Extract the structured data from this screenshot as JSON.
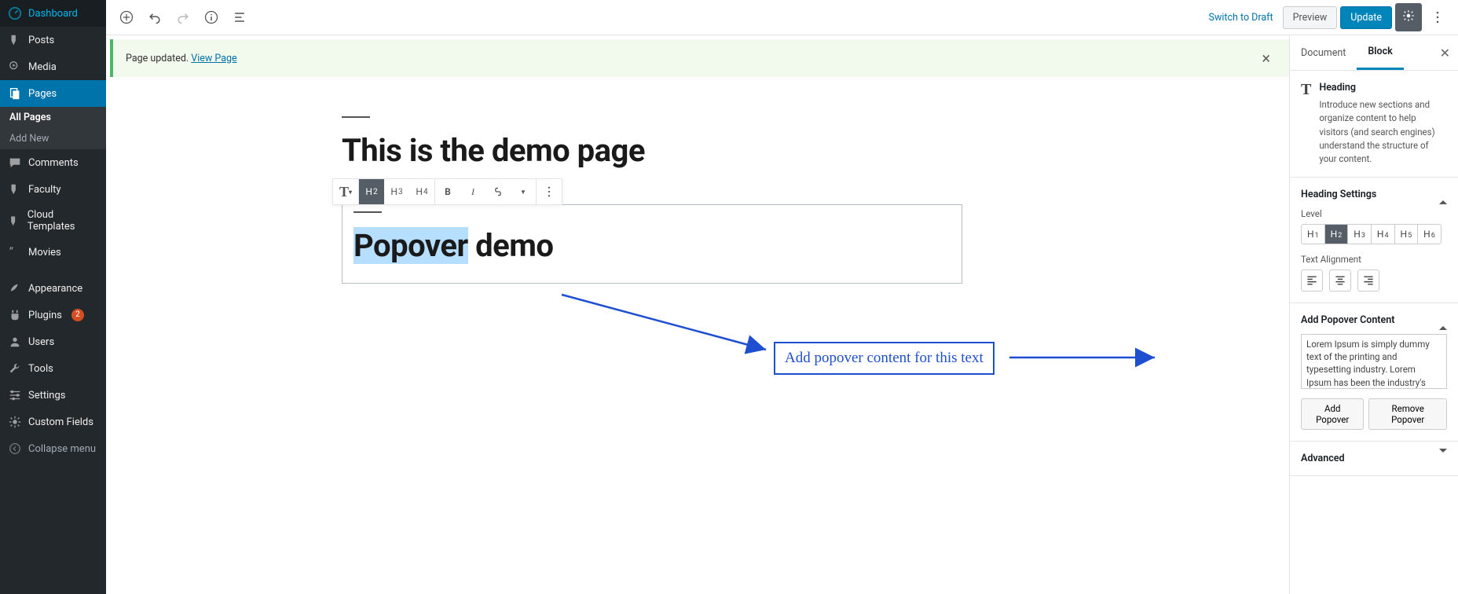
{
  "sidebar": {
    "items": [
      {
        "label": "Dashboard",
        "icon": "dashboard"
      },
      {
        "label": "Posts",
        "icon": "pin"
      },
      {
        "label": "Media",
        "icon": "media"
      },
      {
        "label": "Pages",
        "icon": "pages",
        "active": true
      },
      {
        "label": "Comments",
        "icon": "comments"
      },
      {
        "label": "Faculty",
        "icon": "pin"
      },
      {
        "label": "Cloud Templates",
        "icon": "pin"
      },
      {
        "label": "Movies",
        "icon": "quote"
      },
      {
        "label": "Appearance",
        "icon": "brush"
      },
      {
        "label": "Plugins",
        "icon": "plug",
        "badge": "2"
      },
      {
        "label": "Users",
        "icon": "user"
      },
      {
        "label": "Tools",
        "icon": "wrench"
      },
      {
        "label": "Settings",
        "icon": "sliders"
      },
      {
        "label": "Custom Fields",
        "icon": "cog"
      },
      {
        "label": "Collapse menu",
        "icon": "collapse"
      }
    ],
    "sub": [
      {
        "label": "All Pages",
        "current": true
      },
      {
        "label": "Add New"
      }
    ]
  },
  "topbar": {
    "switch_link": "Switch to Draft",
    "preview": "Preview",
    "update": "Update"
  },
  "notice": {
    "text": "Page updated. ",
    "link": "View Page"
  },
  "canvas": {
    "h1": "This is the demo page",
    "h2_sel": "Popover",
    "h2_rest": " demo"
  },
  "annotation": "Add popover content for this text",
  "rpanel": {
    "tabs": {
      "document": "Document",
      "block": "Block"
    },
    "block_title": "Heading",
    "block_desc": "Introduce new sections and organize content to help visitors (and search engines) understand the structure of your content.",
    "heading_settings": "Heading Settings",
    "level_label": "Level",
    "levels": [
      "1",
      "2",
      "3",
      "4",
      "5",
      "6"
    ],
    "level_active": "2",
    "align_label": "Text Alignment",
    "popover_title": "Add Popover Content",
    "popover_text": "Lorem Ipsum is simply dummy text of the printing and typesetting industry. Lorem Ipsum has been the industry's standard dummy text ever since the",
    "add_btn": "Add Popover",
    "remove_btn": "Remove Popover",
    "advanced": "Advanced"
  }
}
